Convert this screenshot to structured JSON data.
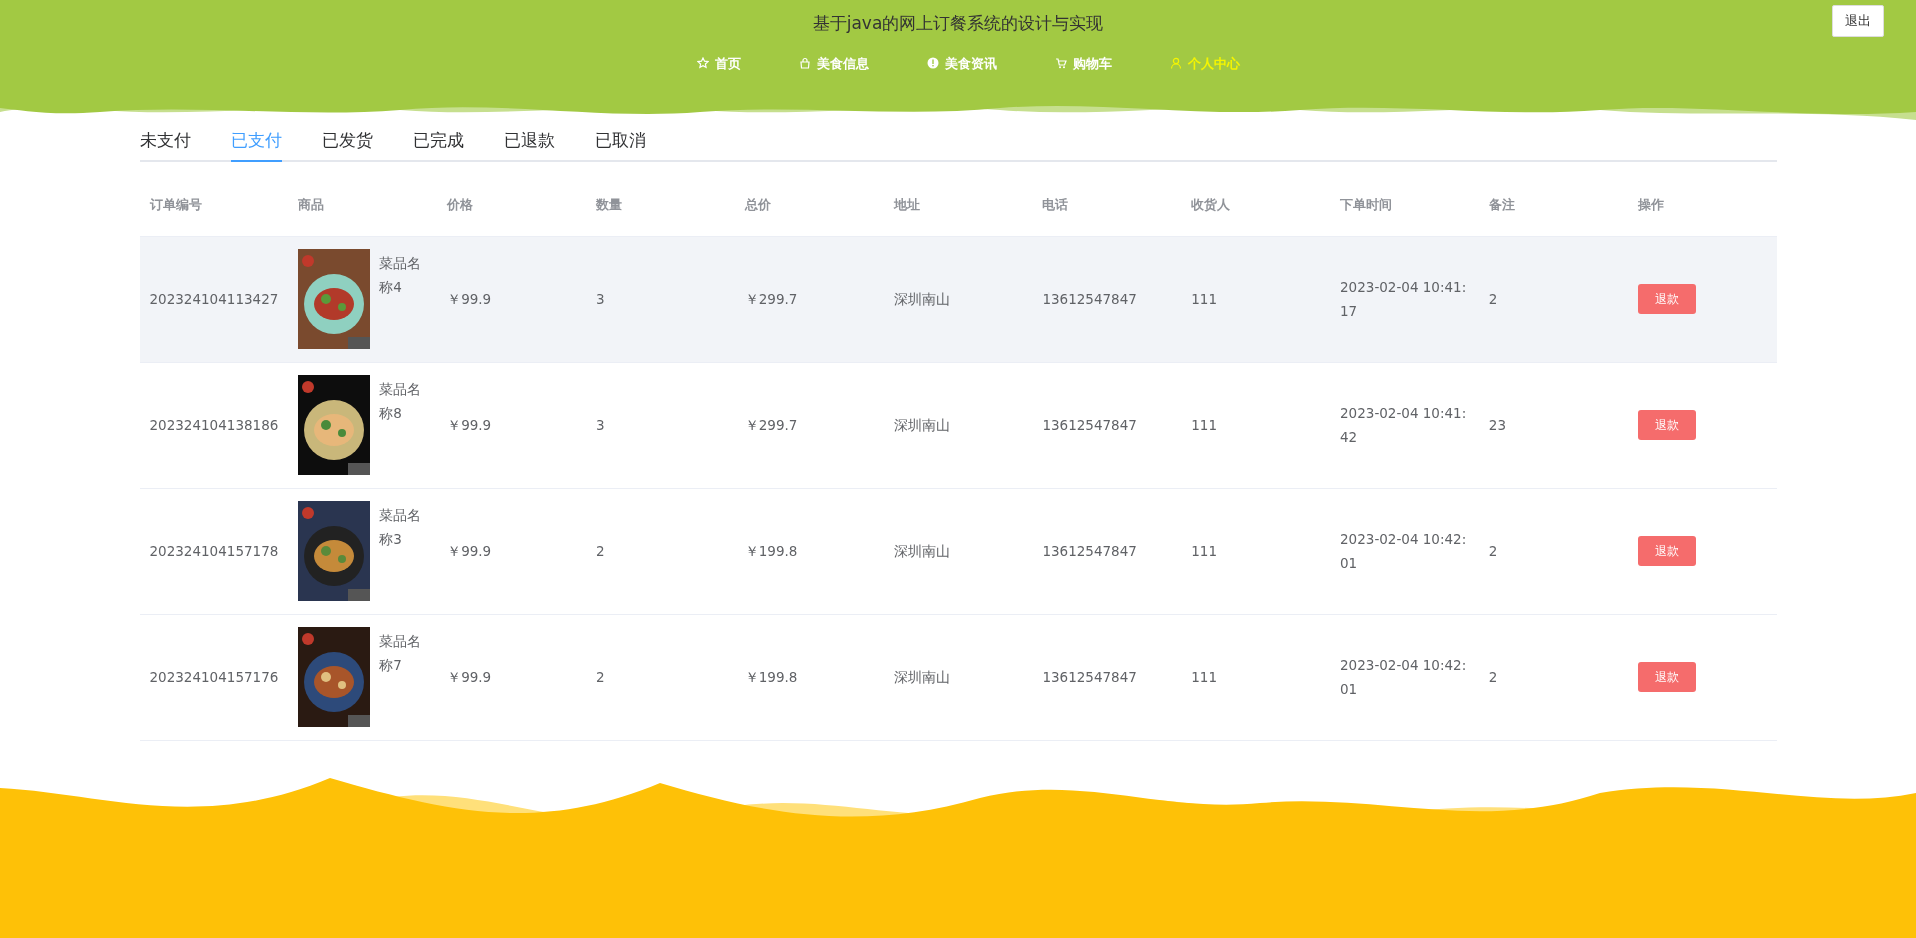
{
  "header": {
    "title": "基于java的网上订餐系统的设计与实现",
    "logout_button": "退出"
  },
  "nav": [
    {
      "label": "首页",
      "selected": false
    },
    {
      "label": "美食信息",
      "selected": false
    },
    {
      "label": "美食资讯",
      "selected": false
    },
    {
      "label": "购物车",
      "selected": false
    },
    {
      "label": "个人中心",
      "selected": true
    }
  ],
  "tabs": [
    {
      "label": "未支付",
      "selected": false
    },
    {
      "label": "已支付",
      "selected": true
    },
    {
      "label": "已发货",
      "selected": false
    },
    {
      "label": "已完成",
      "selected": false
    },
    {
      "label": "已退款",
      "selected": false
    },
    {
      "label": "已取消",
      "selected": false
    }
  ],
  "table": {
    "columns": [
      "订单编号",
      "商品",
      "价格",
      "数量",
      "总价",
      "地址",
      "电话",
      "收货人",
      "下单时间",
      "备注",
      "操作"
    ],
    "rows": [
      {
        "order_no": "202324104113427",
        "product": "菜品名称4",
        "price": "￥99.9",
        "quantity": "3",
        "total": "￥299.7",
        "address": "深圳南山",
        "phone": "13612547847",
        "receiver": "111",
        "time": "2023-02-04 10:41:17",
        "note": "2",
        "action": "退款",
        "hovered": true
      },
      {
        "order_no": "202324104138186",
        "product": "菜品名称8",
        "price": "￥99.9",
        "quantity": "3",
        "total": "￥299.7",
        "address": "深圳南山",
        "phone": "13612547847",
        "receiver": "111",
        "time": "2023-02-04 10:41:42",
        "note": "23",
        "action": "退款",
        "hovered": false
      },
      {
        "order_no": "202324104157178",
        "product": "菜品名称3",
        "price": "￥99.9",
        "quantity": "2",
        "total": "￥199.8",
        "address": "深圳南山",
        "phone": "13612547847",
        "receiver": "111",
        "time": "2023-02-04 10:42:01",
        "note": "2",
        "action": "退款",
        "hovered": false
      },
      {
        "order_no": "202324104157176",
        "product": "菜品名称7",
        "price": "￥99.9",
        "quantity": "2",
        "total": "￥199.8",
        "address": "深圳南山",
        "phone": "13612547847",
        "receiver": "111",
        "time": "2023-02-04 10:42:01",
        "note": "2",
        "action": "退款",
        "hovered": false
      }
    ]
  }
}
